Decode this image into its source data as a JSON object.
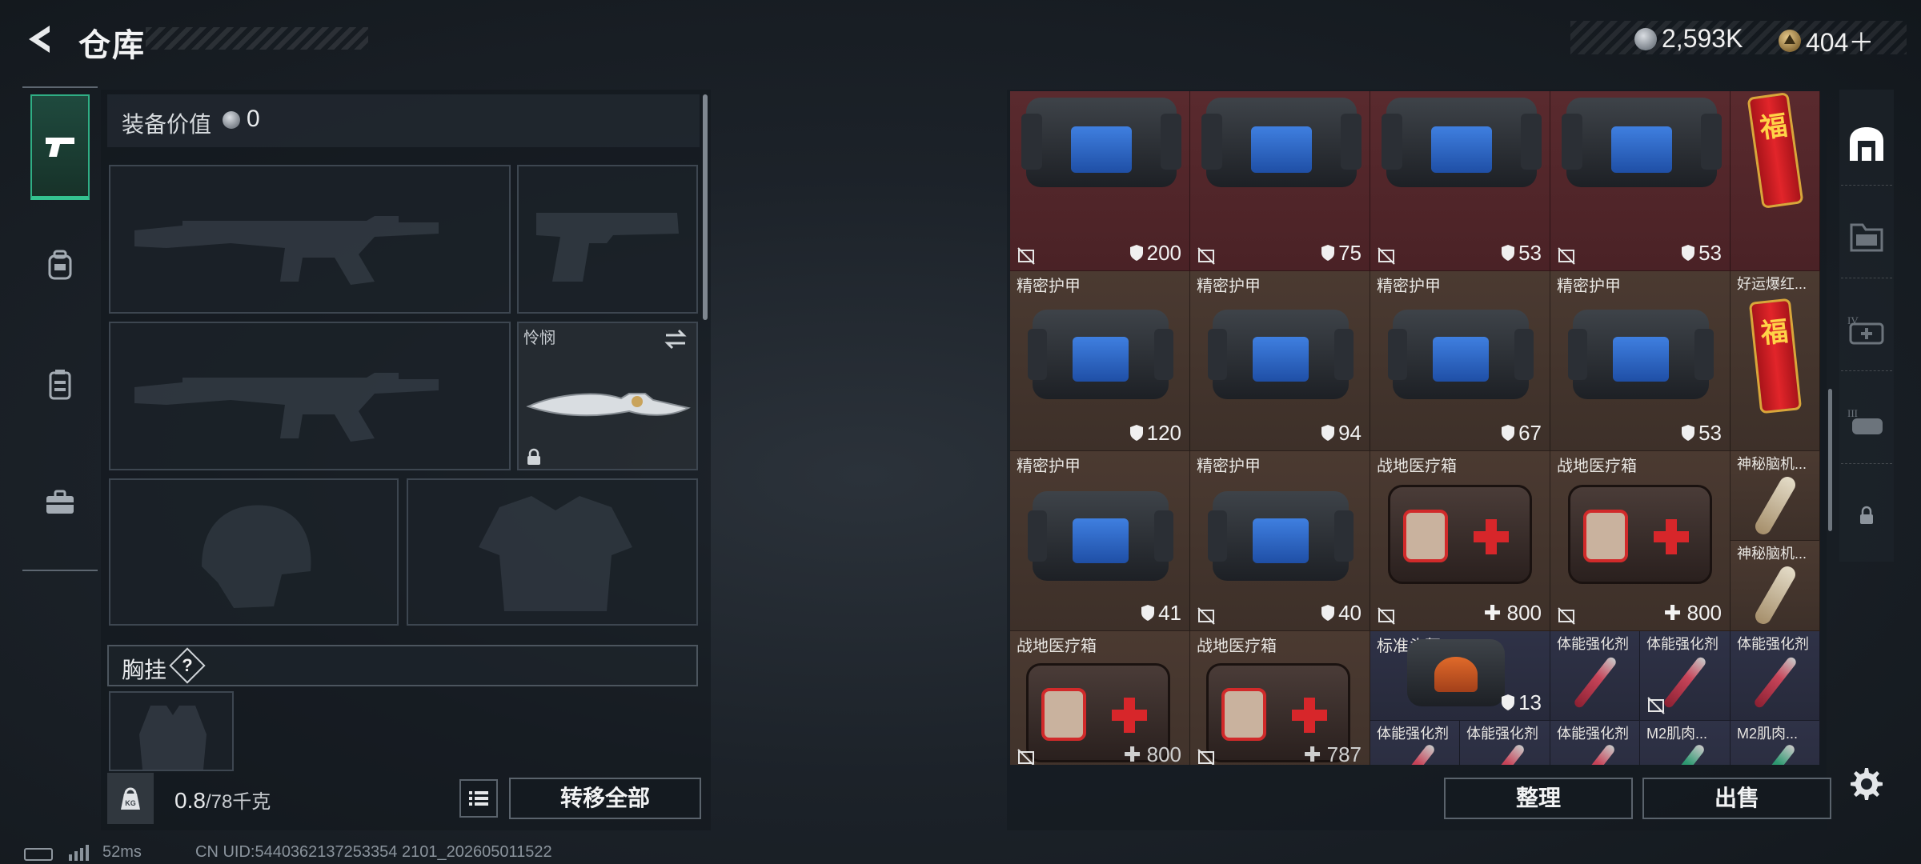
{
  "header": {
    "title": "仓库",
    "currency_silver": "2,593K",
    "currency_gold": "404＋"
  },
  "left_rail": {
    "items": [
      {
        "name": "weapons",
        "active": true
      },
      {
        "name": "backpack",
        "active": false
      },
      {
        "name": "container",
        "active": false
      },
      {
        "name": "toolbox",
        "active": false
      }
    ]
  },
  "loadout": {
    "value_label": "装备价值",
    "value": "0",
    "melee_slot_label": "怜悯",
    "chest_rig_label": "胸挂",
    "help_glyph": "?",
    "weight_current": "0.8",
    "weight_rest": "/78千克",
    "weight_icon_text": "KG",
    "transfer_all_label": "转移全部"
  },
  "stash": {
    "colors": {
      "red": "#5a2a2e",
      "brown": "#4b3a31",
      "blue": "#2f3247"
    },
    "items": [
      {
        "name": "",
        "value": "200",
        "icon": "shield-icon"
      },
      {
        "name": "",
        "value": "75",
        "icon": "shield-icon"
      },
      {
        "name": "",
        "value": "53",
        "icon": "shield-icon"
      },
      {
        "name": "",
        "value": "53",
        "icon": "shield-icon"
      },
      {
        "name": "精密护甲",
        "value": "120",
        "icon": "shield-icon"
      },
      {
        "name": "精密护甲",
        "value": "94",
        "icon": "shield-icon"
      },
      {
        "name": "精密护甲",
        "value": "67",
        "icon": "shield-icon"
      },
      {
        "name": "精密护甲",
        "value": "53",
        "icon": "shield-icon"
      },
      {
        "name": "好运爆红...",
        "value": "",
        "icon": "firecracker"
      },
      {
        "name": "精密护甲",
        "value": "41",
        "icon": "shield-icon"
      },
      {
        "name": "精密护甲",
        "value": "40",
        "icon": "shield-icon"
      },
      {
        "name": "战地医疗箱",
        "value": "800",
        "icon": "plus-icon"
      },
      {
        "name": "战地医疗箱",
        "value": "800",
        "icon": "plus-icon"
      },
      {
        "name": "神秘脑机...",
        "value": "",
        "icon": "brain-chip"
      },
      {
        "name": "神秘脑机...",
        "value": "",
        "icon": "brain-chip"
      },
      {
        "name": "战地医疗箱",
        "value": "800",
        "icon": "plus-icon"
      },
      {
        "name": "战地医疗箱",
        "value": "787",
        "icon": "plus-icon"
      },
      {
        "name": "标准头盔",
        "value": "13",
        "icon": "shield-icon"
      },
      {
        "name": "体能强化剂",
        "value": "",
        "icon": "syringe"
      },
      {
        "name": "体能强化剂",
        "value": "",
        "icon": "syringe"
      },
      {
        "name": "体能强化剂",
        "value": "",
        "icon": "syringe"
      },
      {
        "name": "体能强化剂",
        "value": "",
        "icon": "syringe"
      },
      {
        "name": "体能强化剂",
        "value": "",
        "icon": "syringe"
      },
      {
        "name": "体能强化剂",
        "value": "",
        "icon": "syringe"
      },
      {
        "name": "M2肌肉...",
        "value": "",
        "icon": "syringe"
      },
      {
        "name": "M2肌肉...",
        "value": "",
        "icon": "syringe"
      }
    ],
    "sort_label": "整理",
    "sell_label": "出售"
  },
  "right_rail": {
    "items": [
      {
        "name": "all-items",
        "active": true
      },
      {
        "name": "gear",
        "active": false
      },
      {
        "name": "meds",
        "active": false
      },
      {
        "name": "armor",
        "active": false
      },
      {
        "name": "locked",
        "active": false
      }
    ]
  },
  "status": {
    "ping": "52ms",
    "uid": "CN UID:5440362137253354 2101_202605011522"
  }
}
